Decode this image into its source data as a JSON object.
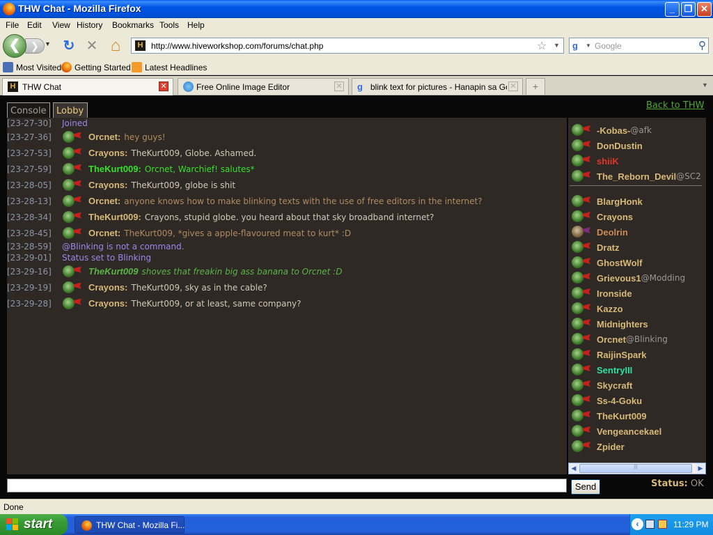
{
  "window": {
    "title": "THW Chat - Mozilla Firefox",
    "minimize": "_",
    "maximize": "❐",
    "close": "✕"
  },
  "menu": [
    "File",
    "Edit",
    "View",
    "History",
    "Bookmarks",
    "Tools",
    "Help"
  ],
  "nav": {
    "back": "❮",
    "forward": "❯",
    "reload": "↻",
    "stop": "✕",
    "home": "⌂",
    "url": "http://www.hiveworkshop.com/forums/chat.php",
    "url_favicon": "H",
    "search_placeholder": "Google",
    "search_engine": "g"
  },
  "bookmarks": [
    {
      "label": "Most Visited",
      "icon": "bookmark-icon"
    },
    {
      "label": "Getting Started",
      "icon": "firefox-icon"
    },
    {
      "label": "Latest Headlines",
      "icon": "rss-icon"
    }
  ],
  "tabs": [
    {
      "label": "THW Chat",
      "active": true
    },
    {
      "label": "Free Online Image Editor",
      "active": false
    },
    {
      "label": "blink text for pictures - Hanapin sa Goo...",
      "active": false
    }
  ],
  "new_tab": "+",
  "chat": {
    "channel_tabs": [
      "Console",
      "Lobby"
    ],
    "back_link": "Back to THW",
    "messages": [
      {
        "ts": "[23-27-30]",
        "type": "sys",
        "text": "Joined"
      },
      {
        "ts": "[23-27-36]",
        "type": "msg",
        "name": "Orcnet:",
        "text": "hey guys!",
        "name_color": "#d7b978",
        "text_color": "#b08a60"
      },
      {
        "ts": "[23-27-53]",
        "type": "msg",
        "name": "Crayons:",
        "text": "TheKurt009, Globe. Ashamed.",
        "name_color": "#d7b978",
        "text_color": "#d2c7b6"
      },
      {
        "ts": "[23-27-59]",
        "type": "msg",
        "name": "TheKurt009:",
        "text": "Orcnet, Warchief! salutes*",
        "name_color": "#37e02c",
        "text_color": "#37e02c"
      },
      {
        "ts": "[23-28-05]",
        "type": "msg",
        "name": "Crayons:",
        "text": "TheKurt009, globe is shit",
        "name_color": "#d7b978",
        "text_color": "#d2c7b6"
      },
      {
        "ts": "[23-28-13]",
        "type": "msg",
        "name": "Orcnet:",
        "text": "anyone knows how to make blinking texts with the use of free editors in the internet?",
        "name_color": "#d7b978",
        "text_color": "#b08a60"
      },
      {
        "ts": "[23-28-34]",
        "type": "msg",
        "name": "TheKurt009:",
        "text": "Crayons, stupid globe. you heard about that sky broadband internet?",
        "name_color": "#d7b978",
        "text_color": "#d2c7b6"
      },
      {
        "ts": "[23-28-45]",
        "type": "msg",
        "name": "Orcnet:",
        "text": "TheKurt009, *gives a apple-flavoured meat to kurt* :D",
        "name_color": "#d7b978",
        "text_color": "#b08a60"
      },
      {
        "ts": "[23-28-59]",
        "type": "sys",
        "text": "@Blinking is not a command."
      },
      {
        "ts": "[23-29-01]",
        "type": "sys",
        "text": "Status set to Blinking"
      },
      {
        "ts": "[23-29-16]",
        "type": "msg",
        "name": "TheKurt009",
        "text": "shoves that freakin big ass banana to Orcnet :D",
        "name_color": "#5ab447",
        "text_color": "#5ab447",
        "italic": true
      },
      {
        "ts": "[23-29-19]",
        "type": "msg",
        "name": "Crayons:",
        "text": "TheKurt009, sky as in the cable?",
        "name_color": "#d7b978",
        "text_color": "#d2c7b6"
      },
      {
        "ts": "[23-29-28]",
        "type": "msg",
        "name": "Crayons:",
        "text": "TheKurt009, or at least, same company?",
        "name_color": "#d7b978",
        "text_color": "#d2c7b6"
      }
    ],
    "staff": [
      {
        "name": "-Kobas-",
        "status": "@afk",
        "color": "#d7b978"
      },
      {
        "name": "DonDustin",
        "status": "",
        "color": "#d7b978"
      },
      {
        "name": "shiiK",
        "status": "",
        "color": "#e0352a"
      },
      {
        "name": "The_Reborn_Devil",
        "status": "@SC2",
        "color": "#d7b978"
      }
    ],
    "users": [
      {
        "name": "BlargHonk",
        "status": "",
        "color": "#d7b978"
      },
      {
        "name": "Crayons",
        "status": "",
        "color": "#d7b978"
      },
      {
        "name": "Deolrin",
        "status": "",
        "color": "#c98a55",
        "avatar": "alt"
      },
      {
        "name": "Dratz",
        "status": "",
        "color": "#d7b978"
      },
      {
        "name": "GhostWolf",
        "status": "",
        "color": "#d7b978"
      },
      {
        "name": "Grievous1",
        "status": "@Modding",
        "color": "#d7b978"
      },
      {
        "name": "Ironside",
        "status": "",
        "color": "#d7b978"
      },
      {
        "name": "Kazzo",
        "status": "",
        "color": "#d7b978"
      },
      {
        "name": "Midnighters",
        "status": "",
        "color": "#d7b978"
      },
      {
        "name": "Orcnet",
        "status": "@Blinking",
        "color": "#d7b978"
      },
      {
        "name": "RaijinSpark",
        "status": "",
        "color": "#d7b978"
      },
      {
        "name": "SentryIII",
        "status": "",
        "color": "#2ee0a0"
      },
      {
        "name": "Skycraft",
        "status": "",
        "color": "#d7b978"
      },
      {
        "name": "Ss-4-Goku",
        "status": "",
        "color": "#d7b978"
      },
      {
        "name": "TheKurt009",
        "status": "",
        "color": "#d7b978"
      },
      {
        "name": "Vengeancekael",
        "status": "",
        "color": "#d7b978"
      },
      {
        "name": "Zpider",
        "status": "",
        "color": "#d7b978"
      }
    ],
    "input_value": "",
    "send_label": "Send",
    "status_label": "Status:",
    "status_value": "OK"
  },
  "statusbar": "Done",
  "taskbar": {
    "start": "start",
    "item": "THW Chat - Mozilla Fi...",
    "clock": "11:29 PM"
  },
  "colors": {
    "timestamp": "#8b95a8",
    "system": "#9b86e8",
    "panel": "#2f2926",
    "link": "#4ea832"
  }
}
